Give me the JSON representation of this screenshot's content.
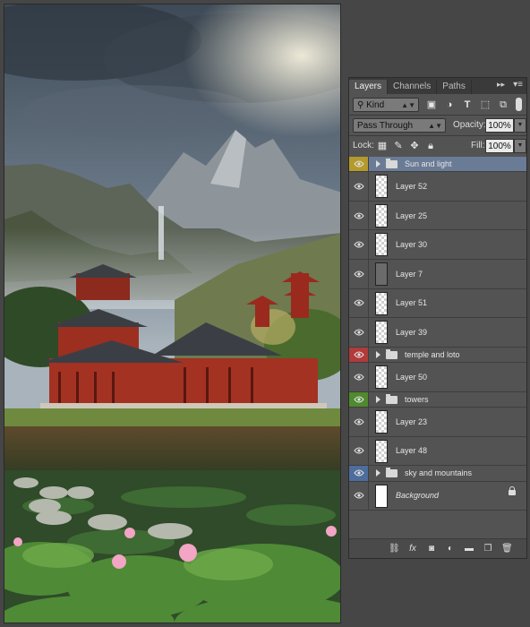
{
  "tabs": [
    {
      "label": "Layers",
      "active": true
    },
    {
      "label": "Channels",
      "active": false
    },
    {
      "label": "Paths",
      "active": false
    }
  ],
  "collapse_glyph": "▸▸",
  "menu_glyph": "▾≡",
  "filter": {
    "select_label": "Kind",
    "search_glyph": "⚲"
  },
  "blend": {
    "mode": "Pass Through",
    "opacity_label": "Opacity:",
    "opacity_value": "100%"
  },
  "lock": {
    "label": "Lock:",
    "fill_label": "Fill:",
    "fill_value": "100%"
  },
  "layers": [
    {
      "name": "Sun and light",
      "type": "group",
      "color": "#b39a2b",
      "selected": true
    },
    {
      "name": "Layer 52",
      "type": "layer",
      "thumb": "checker"
    },
    {
      "name": "Layer 25",
      "type": "layer",
      "thumb": "checker"
    },
    {
      "name": "Layer 30",
      "type": "layer",
      "thumb": "checker"
    },
    {
      "name": "Layer 7",
      "type": "layer",
      "thumb": "dark"
    },
    {
      "name": "Layer 51",
      "type": "layer",
      "thumb": "checker"
    },
    {
      "name": "Layer 39",
      "type": "layer",
      "thumb": "checker"
    },
    {
      "name": "temple and loto",
      "type": "group",
      "color": "#b23a3a"
    },
    {
      "name": "Layer 50",
      "type": "layer",
      "thumb": "checker"
    },
    {
      "name": "towers",
      "type": "group",
      "color": "#4f8a2e"
    },
    {
      "name": "Layer 23",
      "type": "layer",
      "thumb": "checker"
    },
    {
      "name": "Layer 48",
      "type": "layer",
      "thumb": "checker"
    },
    {
      "name": "sky and mountains",
      "type": "group",
      "color": "#4e6c9c"
    },
    {
      "name": "Background",
      "type": "background",
      "thumb": "white",
      "locked": true
    }
  ],
  "bottom_icons": [
    "link-icon",
    "fx-icon",
    "mask-icon",
    "adjustment-icon",
    "new-group-icon",
    "new-layer-icon",
    "trash-icon"
  ]
}
